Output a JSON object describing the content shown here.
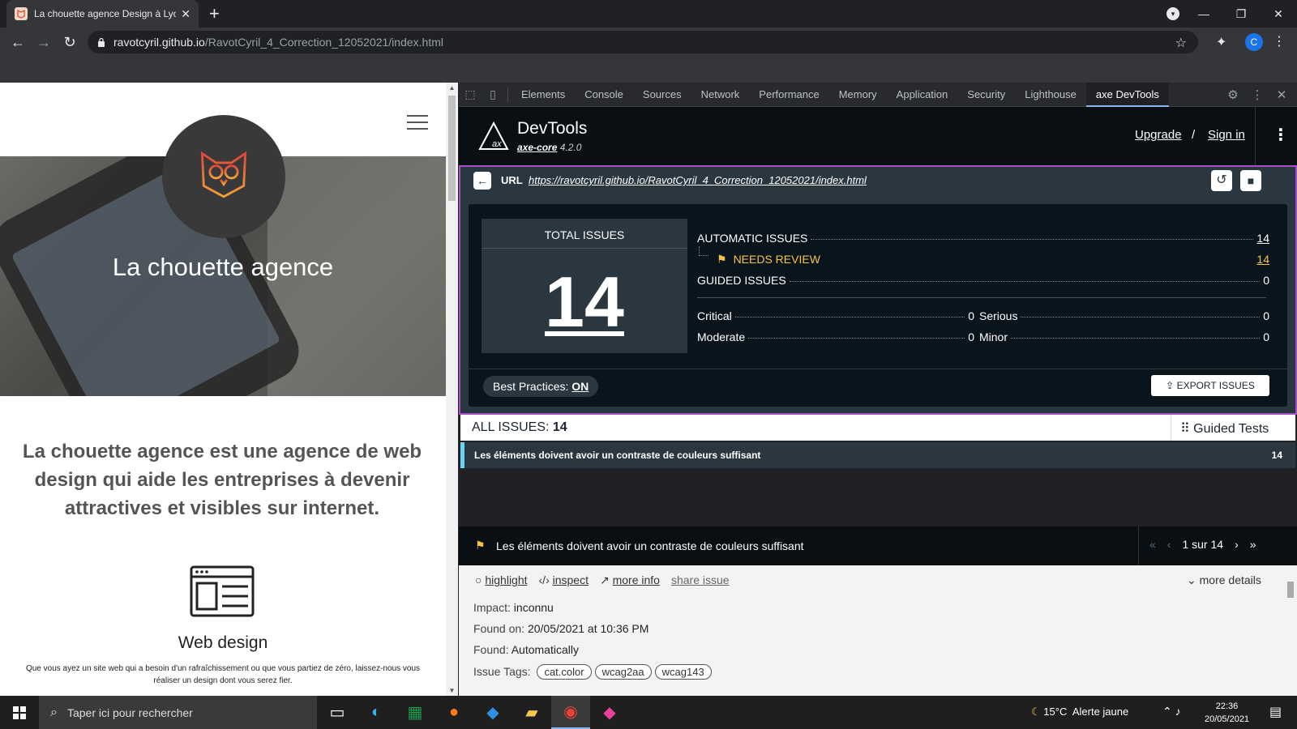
{
  "browser": {
    "tab_title": "La chouette agence Design à Lyon",
    "tab_close": "✕",
    "new_tab": "+",
    "url_host": "ravotcyril.github.io",
    "url_path": "/RavotCyril_4_Correction_12052021/index.html",
    "avatar_letter": "C"
  },
  "page": {
    "hero_title": "La chouette agence",
    "intro": "La chouette agence est une agence de web design qui aide les entreprises à devenir attractives et visibles sur internet.",
    "service_title": "Web design",
    "service_text": "Que vous ayez un site web qui a besoin d'un rafraîchissement ou que vous partiez de zéro, laissez-nous vous réaliser un design dont vous serez fier."
  },
  "devtools": {
    "tabs": [
      "Elements",
      "Console",
      "Sources",
      "Network",
      "Performance",
      "Memory",
      "Application",
      "Security",
      "Lighthouse",
      "axe DevTools"
    ],
    "active_tab": "axe DevTools"
  },
  "axe": {
    "name": "DevTools",
    "core_label": "axe-core",
    "core_version": "4.2.0",
    "upgrade": "Upgrade",
    "slash": "/",
    "sign_in": "Sign in",
    "url_label": "URL",
    "url": "https://ravotcyril.github.io/RavotCyril_4_Correction_12052021/index.html",
    "total_label": "TOTAL ISSUES",
    "total": "14",
    "automatic_label": "AUTOMATIC ISSUES",
    "automatic": "14",
    "needs_review_label": "NEEDS REVIEW",
    "needs_review": "14",
    "guided_label": "GUIDED ISSUES",
    "guided": "0",
    "critical_label": "Critical",
    "critical": "0",
    "serious_label": "Serious",
    "serious": "0",
    "moderate_label": "Moderate",
    "moderate": "0",
    "minor_label": "Minor",
    "minor": "0",
    "best_practices_label": "Best Practices:",
    "best_practices": "ON",
    "export": "EXPORT ISSUES",
    "all_issues_label": "ALL ISSUES:",
    "all_issues": "14",
    "guided_tests": "Guided Tests",
    "issue_title": "Les éléments doivent avoir un contraste de couleurs suffisant",
    "issue_count": "14",
    "pager": "1 sur 14",
    "actions": {
      "highlight": "highlight",
      "inspect": "inspect",
      "more_info": "more info",
      "share": "share issue",
      "more_details": "more details"
    },
    "impact_label": "Impact:",
    "impact": "inconnu",
    "found_on_label": "Found on:",
    "found_on": "20/05/2021 at 10:36 PM",
    "found_label": "Found:",
    "found": "Automatically",
    "tags_label": "Issue Tags:",
    "tags": [
      "cat.color",
      "wcag2aa",
      "wcag143"
    ]
  },
  "taskbar": {
    "search_placeholder": "Taper ici pour rechercher",
    "temperature": "15°C",
    "weather_alert": "Alerte jaune",
    "time": "22:36",
    "date": "20/05/2021"
  },
  "colors": {
    "axe_dark": "#0a141c",
    "axe_panel": "#2a3740",
    "axe_purple": "#a54fc7",
    "review_yellow": "#f5c543",
    "issue_accent": "#6dd3f2"
  }
}
